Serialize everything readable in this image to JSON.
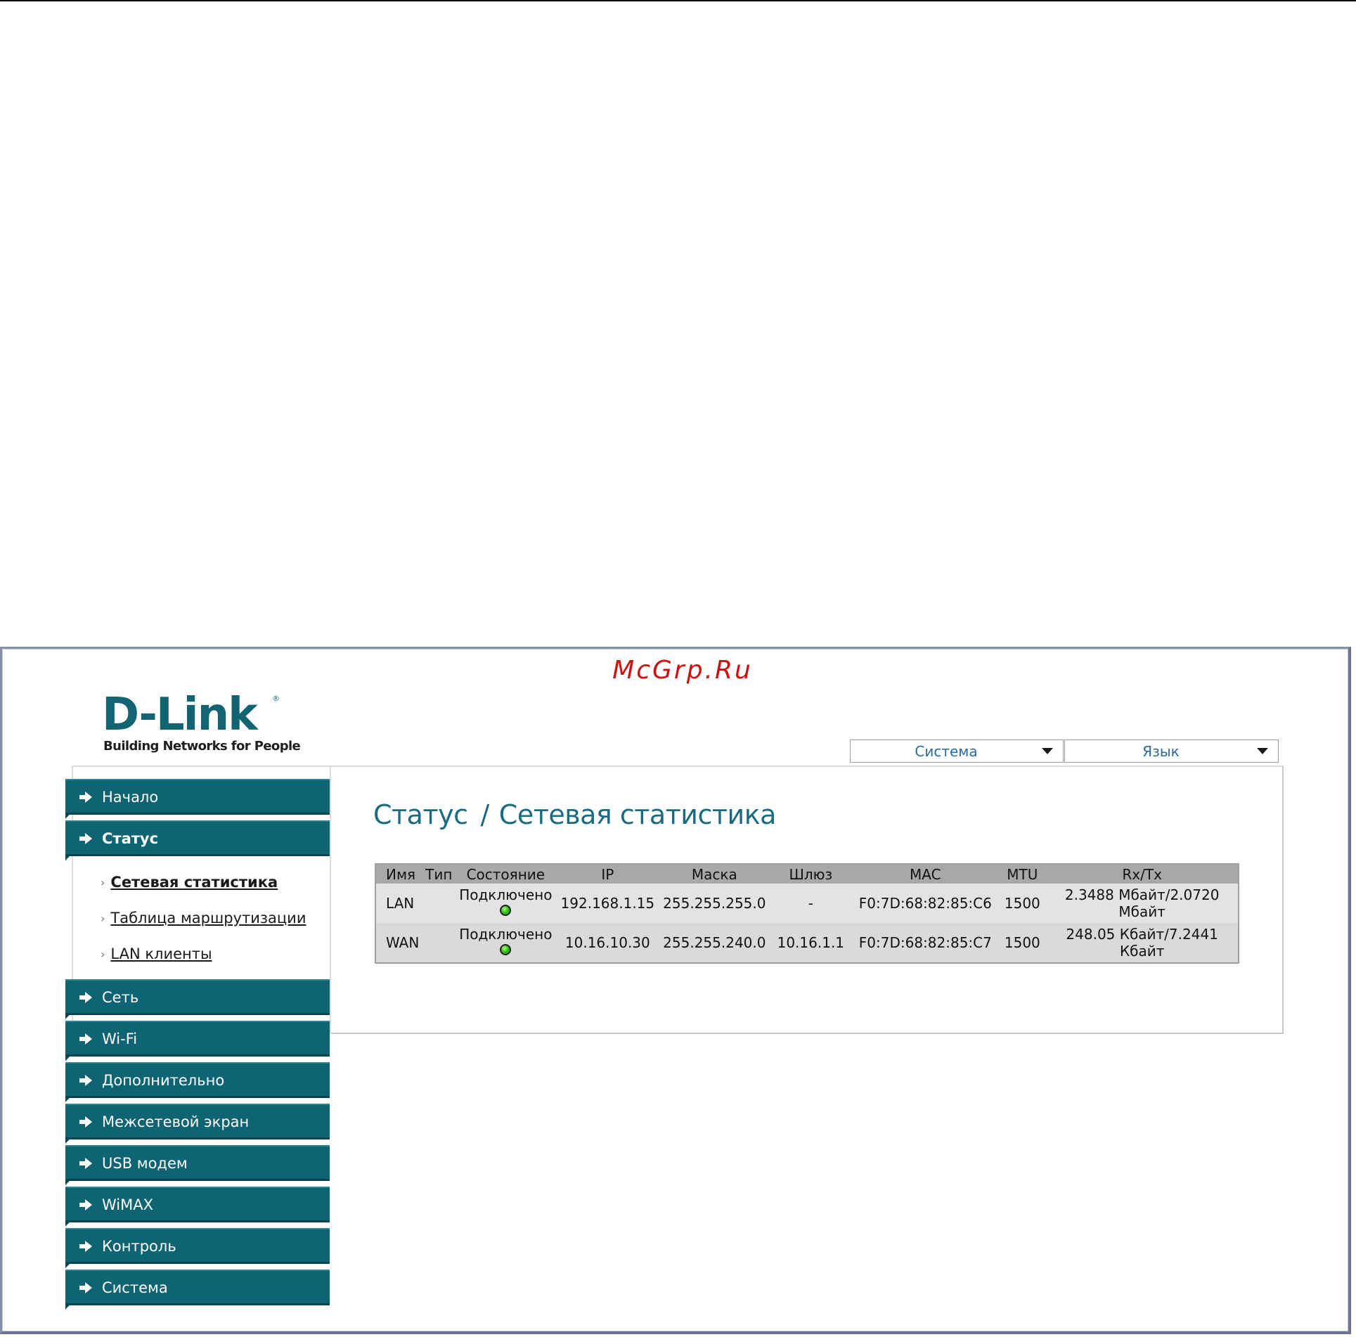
{
  "watermark": "McGrp.Ru",
  "logo": {
    "brand": "D-Link",
    "tagline": "Building Networks for People",
    "reg_mark": "®"
  },
  "menus": {
    "system": "Система",
    "language": "Язык"
  },
  "sidebar": {
    "items": [
      {
        "label": "Начало",
        "active": false
      },
      {
        "label": "Статус",
        "active": true
      },
      {
        "label": "Сеть",
        "active": false
      },
      {
        "label": "Wi-Fi",
        "active": false
      },
      {
        "label": "Дополнительно",
        "active": false
      },
      {
        "label": "Межсетевой экран",
        "active": false
      },
      {
        "label": "USB модем",
        "active": false
      },
      {
        "label": "WiMAX",
        "active": false
      },
      {
        "label": "Контроль",
        "active": false
      },
      {
        "label": "Система",
        "active": false
      }
    ],
    "subitems": [
      {
        "label": "Сетевая статистика",
        "active": true
      },
      {
        "label": "Таблица маршрутизации",
        "active": false
      },
      {
        "label": "LAN клиенты",
        "active": false
      }
    ],
    "bullet": "›"
  },
  "page": {
    "section": "Статус",
    "separator": "/",
    "title": "Сетевая статистика"
  },
  "table": {
    "headers": [
      "Имя",
      "Тип",
      "Состояние",
      "IP",
      "Маска",
      "Шлюз",
      "MAC",
      "MTU",
      "Rx/Tx"
    ],
    "rows": [
      {
        "name": "LAN",
        "type": "",
        "status": "Подключено",
        "ip": "192.168.1.15",
        "mask": "255.255.255.0",
        "gateway": "-",
        "mac": "F0:7D:68:82:85:C6",
        "mtu": "1500",
        "rxtx_line1": "2.3488 Мбайт/2.0720",
        "rxtx_line2": "Мбайт"
      },
      {
        "name": "WAN",
        "type": "",
        "status": "Подключено",
        "ip": "10.16.10.30",
        "mask": "255.255.240.0",
        "gateway": "10.16.1.1",
        "mac": "F0:7D:68:82:85:C7",
        "mtu": "1500",
        "rxtx_line1": "248.05 Кбайт/7.2441",
        "rxtx_line2": "Кбайт"
      }
    ]
  },
  "colors": {
    "nav_bg": "#0f6474",
    "title": "#1a6b80",
    "status_led": "#35c21a",
    "watermark": "#d01010"
  }
}
